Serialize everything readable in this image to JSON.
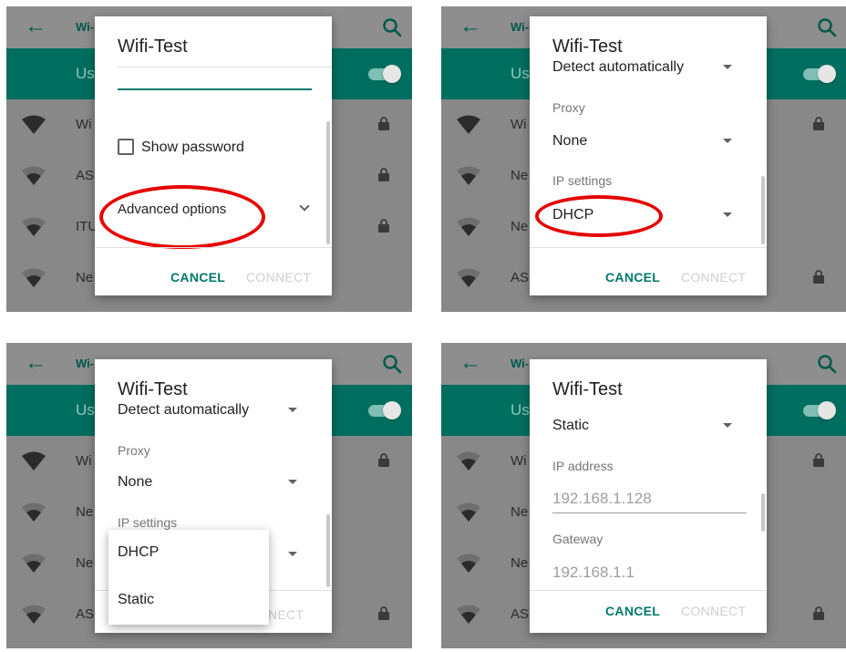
{
  "background_app": {
    "title": "Wi-",
    "switch_label": "Us",
    "networks": {
      "p1": [
        "Wi",
        "AS",
        "ITU",
        "Ne"
      ],
      "p2": [
        "Wi",
        "Ne",
        "Ne",
        "AS"
      ],
      "p3": [
        "Wi",
        "Ne",
        "Ne",
        "AS"
      ],
      "p4": [
        "Wi",
        "Ne",
        "Ne",
        "AS"
      ]
    }
  },
  "dialogs": {
    "p1": {
      "title": "Wifi-Test",
      "show_password": "Show password",
      "advanced_options": "Advanced options",
      "cancel": "CANCEL",
      "connect": "CONNECT"
    },
    "p2": {
      "title": "Wifi-Test",
      "proxy_detect": "Detect automatically",
      "proxy_label": "Proxy",
      "proxy_value": "None",
      "ip_settings_label": "IP settings",
      "ip_settings_value": "DHCP",
      "cancel": "CANCEL",
      "connect": "CONNECT"
    },
    "p3": {
      "title": "Wifi-Test",
      "proxy_detect": "Detect automatically",
      "proxy_label": "Proxy",
      "proxy_value": "None",
      "ip_settings_label": "IP settings",
      "dropdown_options": [
        "DHCP",
        "Static"
      ],
      "connect_partial": "NECT"
    },
    "p4": {
      "title": "Wifi-Test",
      "ip_settings_value": "Static",
      "ip_address_label": "IP address",
      "ip_address_value": "192.168.1.128",
      "gateway_label": "Gateway",
      "gateway_value": "192.168.1.1",
      "cancel": "CANCEL",
      "connect": "CONNECT"
    }
  },
  "colors": {
    "accent": "#00796b",
    "highlight": "#e60000",
    "scrim": "#888888"
  }
}
